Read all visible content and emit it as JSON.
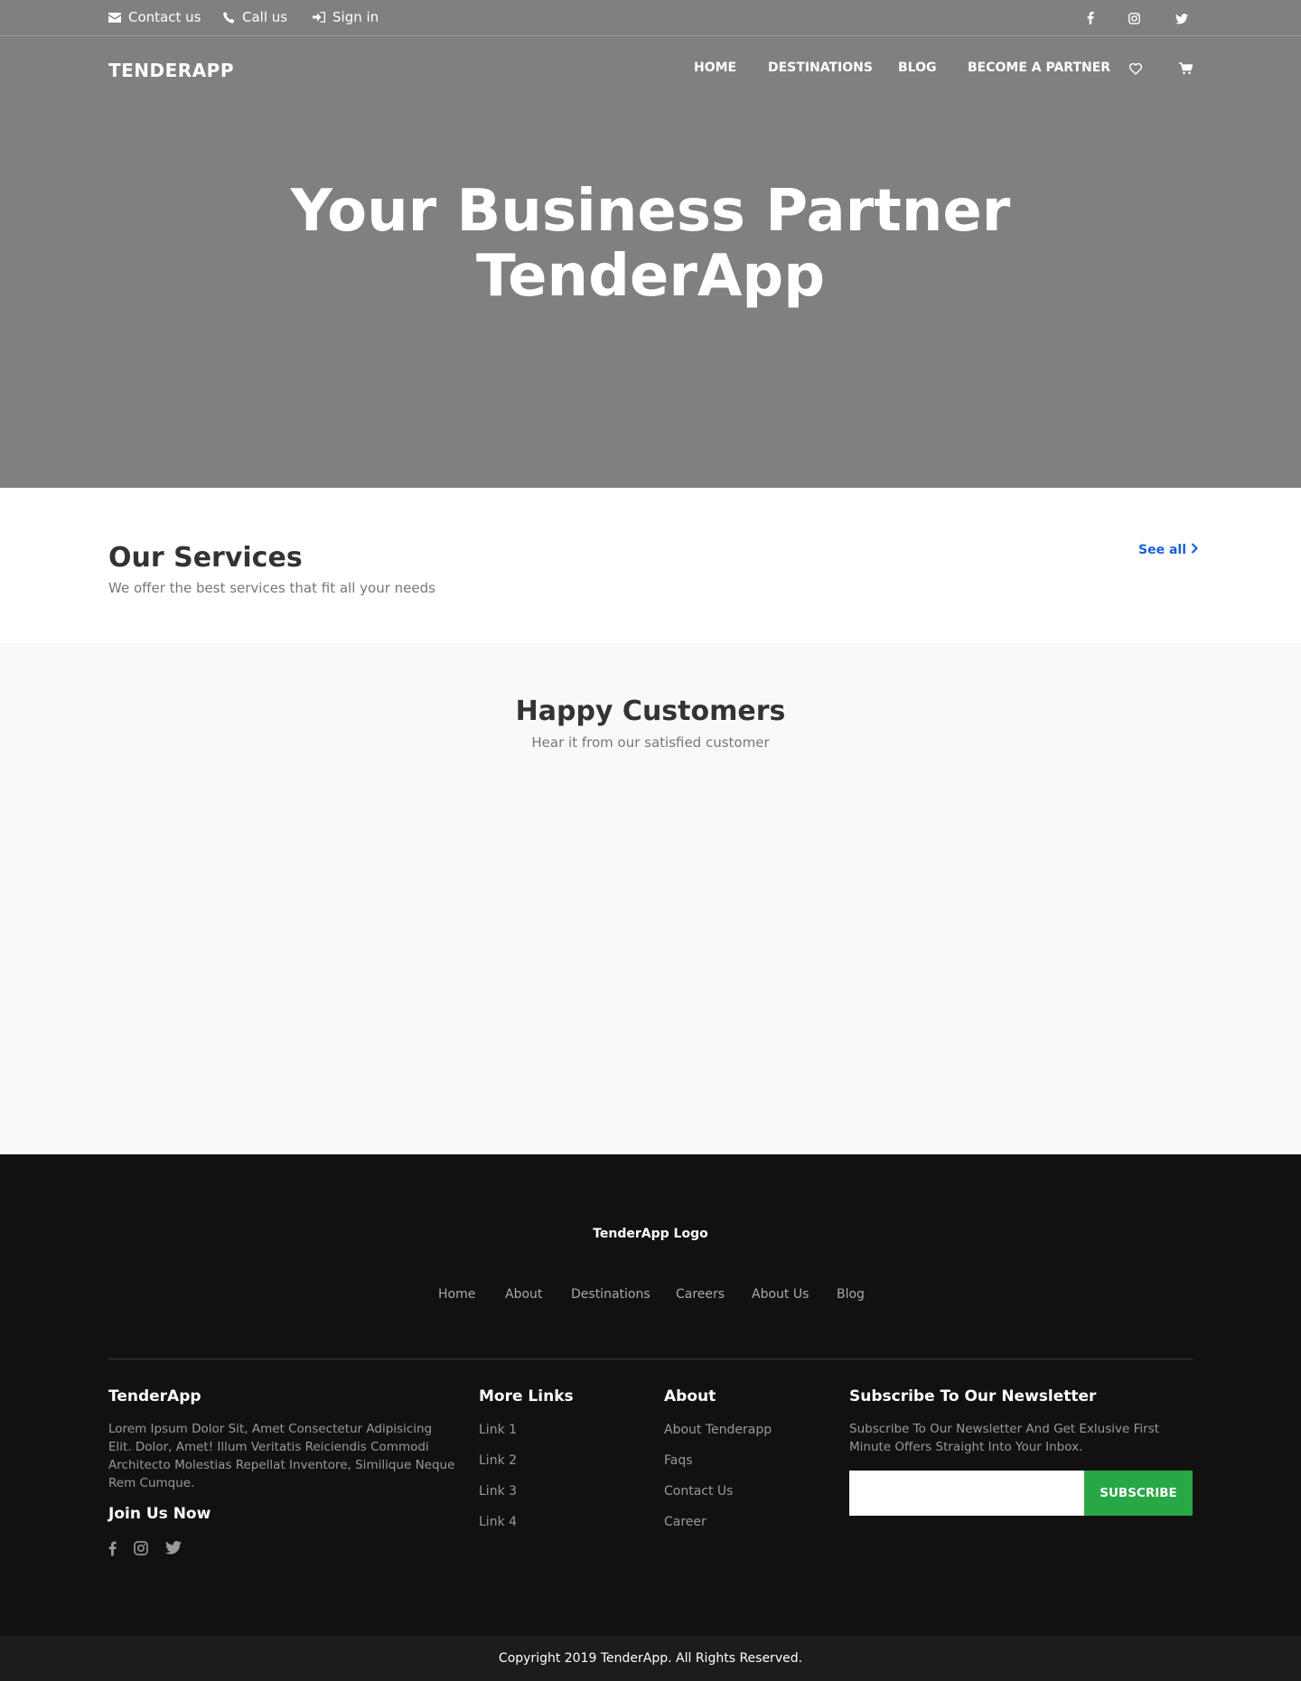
{
  "topbar": {
    "links": [
      {
        "label": "Contact us",
        "icon": "envelope-icon"
      },
      {
        "label": "Call us",
        "icon": "phone-icon"
      },
      {
        "label": "Sign in",
        "icon": "sign-in-icon"
      }
    ],
    "social": [
      "facebook-icon",
      "instagram-icon",
      "twitter-icon"
    ]
  },
  "nav": {
    "brand": "TENDERAPP",
    "items": [
      "HOME",
      "DESTINATIONS",
      "BLOG",
      "BECOME A PARTNER"
    ],
    "icons": [
      "heart-icon",
      "cart-icon"
    ]
  },
  "hero": {
    "title_line1": "Your Business Partner",
    "title_line2": "TenderApp",
    "background": "#808080"
  },
  "services": {
    "title": "Our Services",
    "subtitle": "We offer the best services that fit all your needs",
    "see_all": "See all",
    "link_color": "#1d5ed8"
  },
  "customers": {
    "title": "Happy Customers",
    "subtitle": "Hear it from our satisfied customer"
  },
  "footer": {
    "logo": "TenderApp Logo",
    "nav": [
      "Home",
      "About",
      "Destinations",
      "Careers",
      "About Us",
      "Blog"
    ],
    "about": {
      "title": "TenderApp",
      "text": "Lorem Ipsum Dolor Sit, Amet Consectetur Adipisicing Elit. Dolor, Amet! Illum Veritatis Reiciendis Commodi Architecto Molestias Repellat Inventore, Similique Neque Rem Cumque.",
      "join_title": "Join Us Now",
      "social": [
        "facebook-icon",
        "instagram-icon",
        "twitter-icon"
      ]
    },
    "more_links": {
      "title": "More Links",
      "links": [
        "Link 1",
        "Link 2",
        "Link 3",
        "Link 4"
      ]
    },
    "about_col": {
      "title": "About",
      "links": [
        "About Tenderapp",
        "Faqs",
        "Contact Us",
        "Career"
      ]
    },
    "newsletter": {
      "title": "Subscribe To Our Newsletter",
      "text": "Subscribe To Our Newsletter And Get Exlusive First Minute Offers Straight Into Your Inbox.",
      "input_value": "",
      "button": "SUBSCRIBE",
      "button_color": "#28a745"
    },
    "copyright": "Copyright 2019 TenderApp. All Rights Reserved."
  }
}
